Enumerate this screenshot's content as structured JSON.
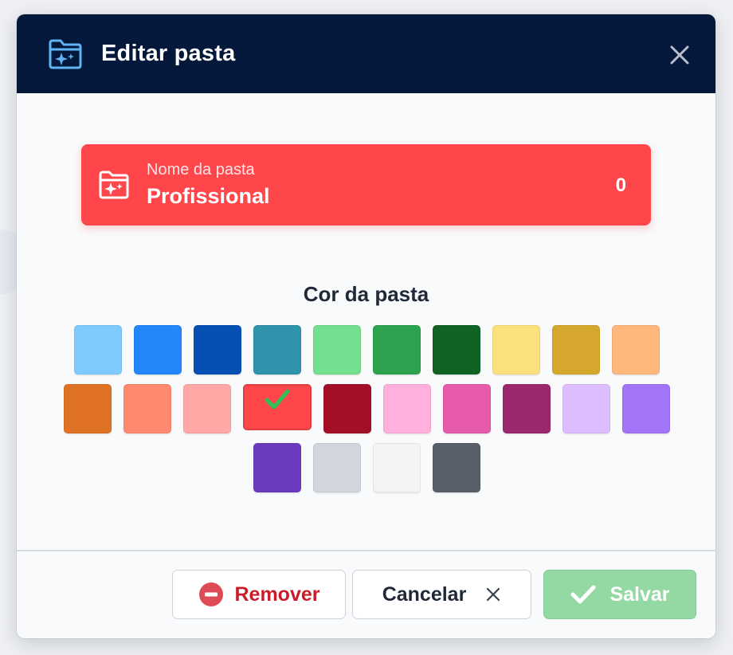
{
  "dialog": {
    "title": "Editar pasta",
    "close_icon": "close-icon",
    "header_icon": "folder-sparkle-icon"
  },
  "folder_card": {
    "label": "Nome da pasta",
    "value": "Profissional",
    "count": "0",
    "icon": "folder-sparkle-icon",
    "color": "#ff464b"
  },
  "color_section": {
    "title": "Cor da pasta",
    "selected_index": 13,
    "swatches": [
      "#7fcbff",
      "#2387fb",
      "#0650b3",
      "#3093ac",
      "#74df8e",
      "#2ea34f",
      "#106325",
      "#fbe07c",
      "#d5a72c",
      "#ffb77c",
      "#e07226",
      "#ff8a6f",
      "#ffa8a6",
      "#ff464b",
      "#a20f27",
      "#ffb0dc",
      "#e65bab",
      "#9b286d",
      "#dcbdff",
      "#a274f8",
      "#6a3bbf",
      "#d1d6dd",
      "#f3f4f6",
      "#595f69"
    ]
  },
  "footer": {
    "remove_label": "Remover",
    "cancel_label": "Cancelar",
    "save_label": "Salvar"
  }
}
